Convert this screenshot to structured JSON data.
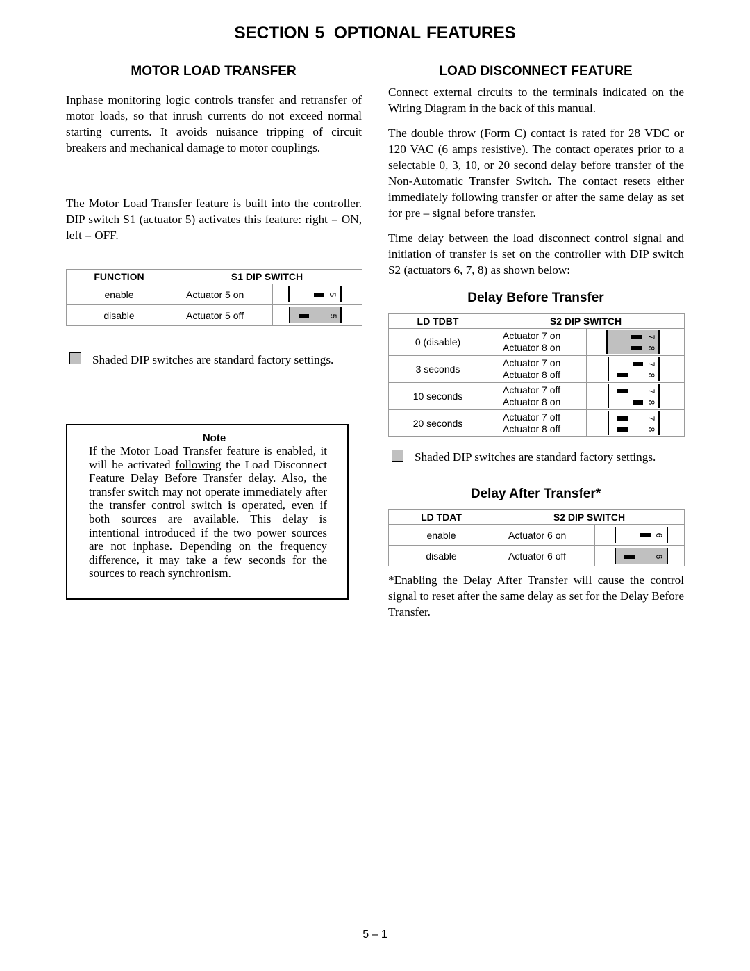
{
  "page": {
    "section_label": "SECTION 5",
    "section_title": "OPTIONAL FEATURES",
    "page_number": "5 – 1"
  },
  "motor_load_transfer": {
    "heading": "MOTOR LOAD TRANSFER",
    "paragraph_1": "Inphase monitoring logic controls transfer and retransfer of motor loads, so that inrush currents do not exceed normal starting currents. It avoids nuisance tripping of circuit breakers and mechanical damage to motor couplings.",
    "paragraph_2": "The Motor Load Transfer feature is built into the controller.  DIP switch S1 (actuator 5) activates this feature:  right = ON, left = OFF.",
    "table": {
      "headers": [
        "FUNCTION",
        "S1 DIP SWITCH"
      ],
      "rows": [
        {
          "function": "enable",
          "actuator": "Actuator 5 on",
          "switch_label": "5",
          "positions": [
            "on"
          ],
          "shaded": false
        },
        {
          "function": "disable",
          "actuator": "Actuator 5 off",
          "switch_label": "5",
          "positions": [
            "off"
          ],
          "shaded": true
        }
      ]
    },
    "legend": "Shaded DIP switches are standard factory settings.",
    "note": {
      "title": "Note",
      "text_before": "If the Motor Load Transfer feature is enabled, it will be activated ",
      "underlined": "following",
      "text_after": " the Load Disconnect Feature Delay Before Transfer delay. Also, the transfer switch may not operate immediately after the transfer control switch is operated, even if both sources are available. This delay is intentional introduced if the two power sources are not inphase. Depending on the frequency difference, it may take a few seconds for the sources to reach synchronism."
    }
  },
  "load_disconnect": {
    "heading": "LOAD DISCONNECT FEATURE",
    "paragraph_1": "Connect external circuits to the terminals indicated on the Wiring Diagram in the back of this manual.",
    "paragraph_2_before": "The double throw (Form C) contact is rated for 28 VDC or 120 VAC (6 amps resistive).  The contact operates prior to a selectable 0, 3, 10, or 20 second delay before transfer of the Non-Automatic Transfer Switch.  The contact resets either immediately following transfer or after the ",
    "paragraph_2_underline_1": "same",
    "paragraph_2_underline_2": "delay",
    "paragraph_2_after": " as set for pre – signal before transfer.",
    "paragraph_3": "Time delay between the load disconnect control signal and initiation of transfer is set on the controller with DIP switch S2 (actuators 6, 7, 8) as shown below:",
    "delay_before": {
      "heading": "Delay Before Transfer",
      "headers": [
        "LD TDBT",
        "S2 DIP SWITCH"
      ],
      "rows": [
        {
          "setting": "0 (disable)",
          "actuator_a": "Actuator 7 on",
          "actuator_b": "Actuator 8 on",
          "labels": [
            "7",
            "8"
          ],
          "positions": [
            "on",
            "on"
          ],
          "shaded": true
        },
        {
          "setting": "3 seconds",
          "actuator_a": "Actuator 7 on",
          "actuator_b": "Actuator 8 off",
          "labels": [
            "7",
            "8"
          ],
          "positions": [
            "on",
            "off"
          ],
          "shaded": false
        },
        {
          "setting": "10 seconds",
          "actuator_a": "Actuator 7 off",
          "actuator_b": "Actuator 8 on",
          "labels": [
            "7",
            "8"
          ],
          "positions": [
            "off",
            "on"
          ],
          "shaded": false
        },
        {
          "setting": "20 seconds",
          "actuator_a": "Actuator 7 off",
          "actuator_b": "Actuator 8 off",
          "labels": [
            "7",
            "8"
          ],
          "positions": [
            "off",
            "off"
          ],
          "shaded": false
        }
      ],
      "legend": "Shaded DIP switches are standard factory settings."
    },
    "delay_after": {
      "heading": "Delay After Transfer*",
      "headers": [
        "LD TDAT",
        "S2 DIP SWITCH"
      ],
      "rows": [
        {
          "setting": "enable",
          "actuator": "Actuator 6 on",
          "switch_label": "6",
          "positions": [
            "on"
          ],
          "shaded": false
        },
        {
          "setting": "disable",
          "actuator": "Actuator 6 off",
          "switch_label": "6",
          "positions": [
            "off"
          ],
          "shaded": true
        }
      ],
      "footnote_before": "*Enabling the Delay After Transfer will cause the control signal to reset after the ",
      "footnote_underlined": "same delay",
      "footnote_after": " as set for the Delay Before Transfer."
    }
  },
  "colors": {
    "shaded": "#c0c0c0",
    "table_border": "#9a9a9a",
    "text": "#000000"
  }
}
